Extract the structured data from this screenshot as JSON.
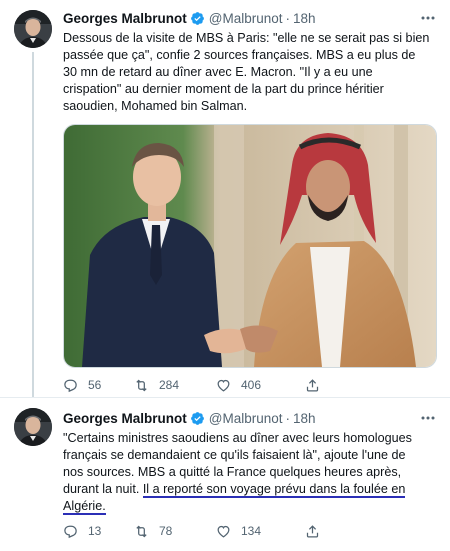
{
  "tweets": [
    {
      "author_name": "Georges Malbrunot",
      "handle": "@Malbrunot",
      "separator": "·",
      "time": "18h",
      "lines": [
        "Dessous de la visite de MBS à Paris: \"elle ne se serait pas si bien",
        "passée que ça\", confie 2 sources françaises. MBS a eu plus de",
        "30 mn de retard au dîner avec E. Macron. \"Il y a eu une",
        "crispation\" au dernier moment de la part du prince héritier",
        "saoudien, Mohamed bin Salman."
      ],
      "replies": "56",
      "retweets": "284",
      "likes": "406"
    },
    {
      "author_name": "Georges Malbrunot",
      "handle": "@Malbrunot",
      "separator": "·",
      "time": "18h",
      "lines": [
        "\"Certains ministres saoudiens au dîner avec leurs homologues",
        "français se demandaient ce qu'ils faisaient là\", ajoute l'une de",
        "nos sources. MBS a quitté la France quelques heures après,"
      ],
      "line4_plain": "durant la nuit. ",
      "line4_underlined": "Il a reporté son voyage prévu dans la foulée en",
      "line5_underlined": "Algérie.",
      "replies": "13",
      "retweets": "78",
      "likes": "134"
    }
  ],
  "icons": {
    "verified": "verified-badge-icon",
    "more": "more-icon",
    "reply": "reply-icon",
    "retweet": "retweet-icon",
    "like": "heart-icon",
    "share": "share-icon"
  },
  "colors": {
    "verified_blue": "#1d9bf0",
    "text": "#0f1419",
    "secondary": "#536471",
    "annotation_underline": "#2b2fb6"
  }
}
